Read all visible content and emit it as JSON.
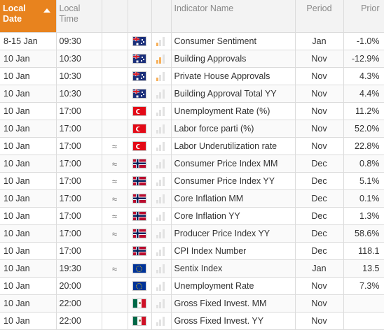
{
  "header": {
    "date_label": "Local\nDate",
    "date_line1": "Local",
    "date_line2": "Date",
    "time_line1": "Local",
    "time_line2": "Time",
    "indicator": "Indicator Name",
    "period": "Period",
    "prior": "Prior"
  },
  "colors": {
    "accent": "#e8831e",
    "importance_on": "#f7b05a",
    "importance_off": "#e2e2e2"
  },
  "rows": [
    {
      "date": "8-15 Jan",
      "time": "09:30",
      "tilde": "",
      "flag": "flag-au-icon",
      "importance": 1,
      "name": "Consumer Sentiment",
      "period": "Jan",
      "prior": "-1.0%"
    },
    {
      "date": "10 Jan",
      "time": "10:30",
      "tilde": "",
      "flag": "flag-au-icon",
      "importance": 2,
      "name": "Building Approvals",
      "period": "Nov",
      "prior": "-12.9%"
    },
    {
      "date": "10 Jan",
      "time": "10:30",
      "tilde": "",
      "flag": "flag-au-icon",
      "importance": 1,
      "name": "Private House Approvals",
      "period": "Nov",
      "prior": "4.3%"
    },
    {
      "date": "10 Jan",
      "time": "10:30",
      "tilde": "",
      "flag": "flag-au-icon",
      "importance": 0,
      "name": "Building Approval Total YY",
      "period": "Nov",
      "prior": "4.4%"
    },
    {
      "date": "10 Jan",
      "time": "17:00",
      "tilde": "",
      "flag": "flag-tr-icon",
      "importance": 0,
      "name": "Unemployment Rate (%)",
      "period": "Nov",
      "prior": "11.2%"
    },
    {
      "date": "10 Jan",
      "time": "17:00",
      "tilde": "",
      "flag": "flag-tr-icon",
      "importance": 0,
      "name": "Labor force parti (%)",
      "period": "Nov",
      "prior": "52.0%"
    },
    {
      "date": "10 Jan",
      "time": "17:00",
      "tilde": "≈",
      "flag": "flag-tr-icon",
      "importance": 0,
      "name": "Labor Underutilization rate",
      "period": "Nov",
      "prior": "22.8%"
    },
    {
      "date": "10 Jan",
      "time": "17:00",
      "tilde": "≈",
      "flag": "flag-no-icon",
      "importance": 0,
      "name": "Consumer Price Index MM",
      "period": "Dec",
      "prior": "0.8%"
    },
    {
      "date": "10 Jan",
      "time": "17:00",
      "tilde": "≈",
      "flag": "flag-no-icon",
      "importance": 0,
      "name": "Consumer Price Index YY",
      "period": "Dec",
      "prior": "5.1%"
    },
    {
      "date": "10 Jan",
      "time": "17:00",
      "tilde": "≈",
      "flag": "flag-no-icon",
      "importance": 0,
      "name": "Core Inflation MM",
      "period": "Dec",
      "prior": "0.1%"
    },
    {
      "date": "10 Jan",
      "time": "17:00",
      "tilde": "≈",
      "flag": "flag-no-icon",
      "importance": 0,
      "name": "Core Inflation YY",
      "period": "Dec",
      "prior": "1.3%"
    },
    {
      "date": "10 Jan",
      "time": "17:00",
      "tilde": "≈",
      "flag": "flag-no-icon",
      "importance": 0,
      "name": "Producer Price Index YY",
      "period": "Dec",
      "prior": "58.6%"
    },
    {
      "date": "10 Jan",
      "time": "17:00",
      "tilde": "",
      "flag": "flag-no-icon",
      "importance": 0,
      "name": "CPI Index Number",
      "period": "Dec",
      "prior": "118.1"
    },
    {
      "date": "10 Jan",
      "time": "19:30",
      "tilde": "≈",
      "flag": "flag-eu-icon",
      "importance": 0,
      "name": "Sentix Index",
      "period": "Jan",
      "prior": "13.5"
    },
    {
      "date": "10 Jan",
      "time": "20:00",
      "tilde": "",
      "flag": "flag-eu-icon",
      "importance": 0,
      "name": "Unemployment Rate",
      "period": "Nov",
      "prior": "7.3%"
    },
    {
      "date": "10 Jan",
      "time": "22:00",
      "tilde": "",
      "flag": "flag-mx-icon",
      "importance": 0,
      "name": "Gross Fixed Invest. MM",
      "period": "Nov",
      "prior": ""
    },
    {
      "date": "10 Jan",
      "time": "22:00",
      "tilde": "",
      "flag": "flag-mx-icon",
      "importance": 0,
      "name": "Gross Fixed Invest. YY",
      "period": "Nov",
      "prior": ""
    }
  ]
}
